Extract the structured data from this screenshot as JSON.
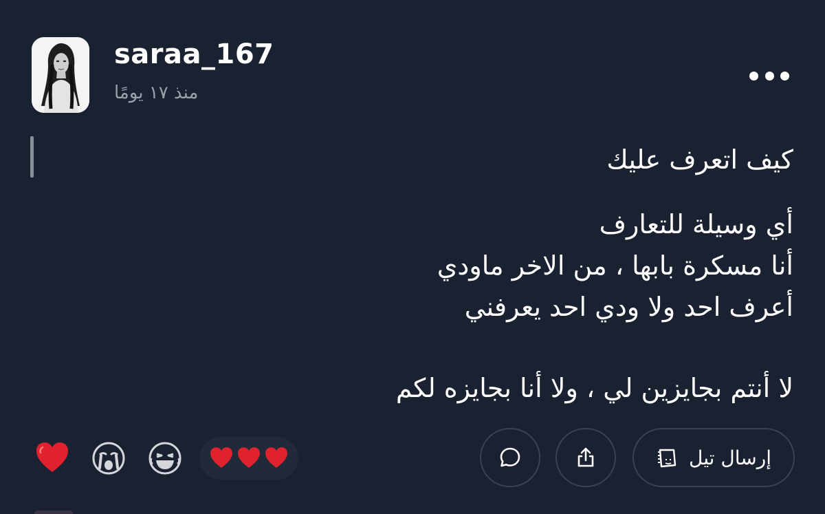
{
  "post": {
    "username": "saraa_167",
    "timestamp": "منذ ١٧ يومًا",
    "lines": {
      "title": "كيف اتعرف عليك",
      "line1": "أي وسيلة للتعارف",
      "line2": "أنا مسكرة بابها ، من الاخر ماودي",
      "line3": "أعرف احد ولا ودي احد يعرفني",
      "line4": "لا أنتم بجايزين لي ، ولا أنا بجايزه لكم"
    }
  },
  "actions": {
    "send_label": "إرسال تيل"
  },
  "reactions": [
    {
      "icon": "red-heart-icon"
    },
    {
      "icon": "crying-face-icon"
    },
    {
      "icon": "laughing-face-icon"
    },
    {
      "icon": "hearts-group-icon"
    }
  ],
  "colors": {
    "background": "#1a2130",
    "text": "#ffffff",
    "muted": "#9aa1ad",
    "border": "#3a4254",
    "heart": "#e0222f"
  }
}
